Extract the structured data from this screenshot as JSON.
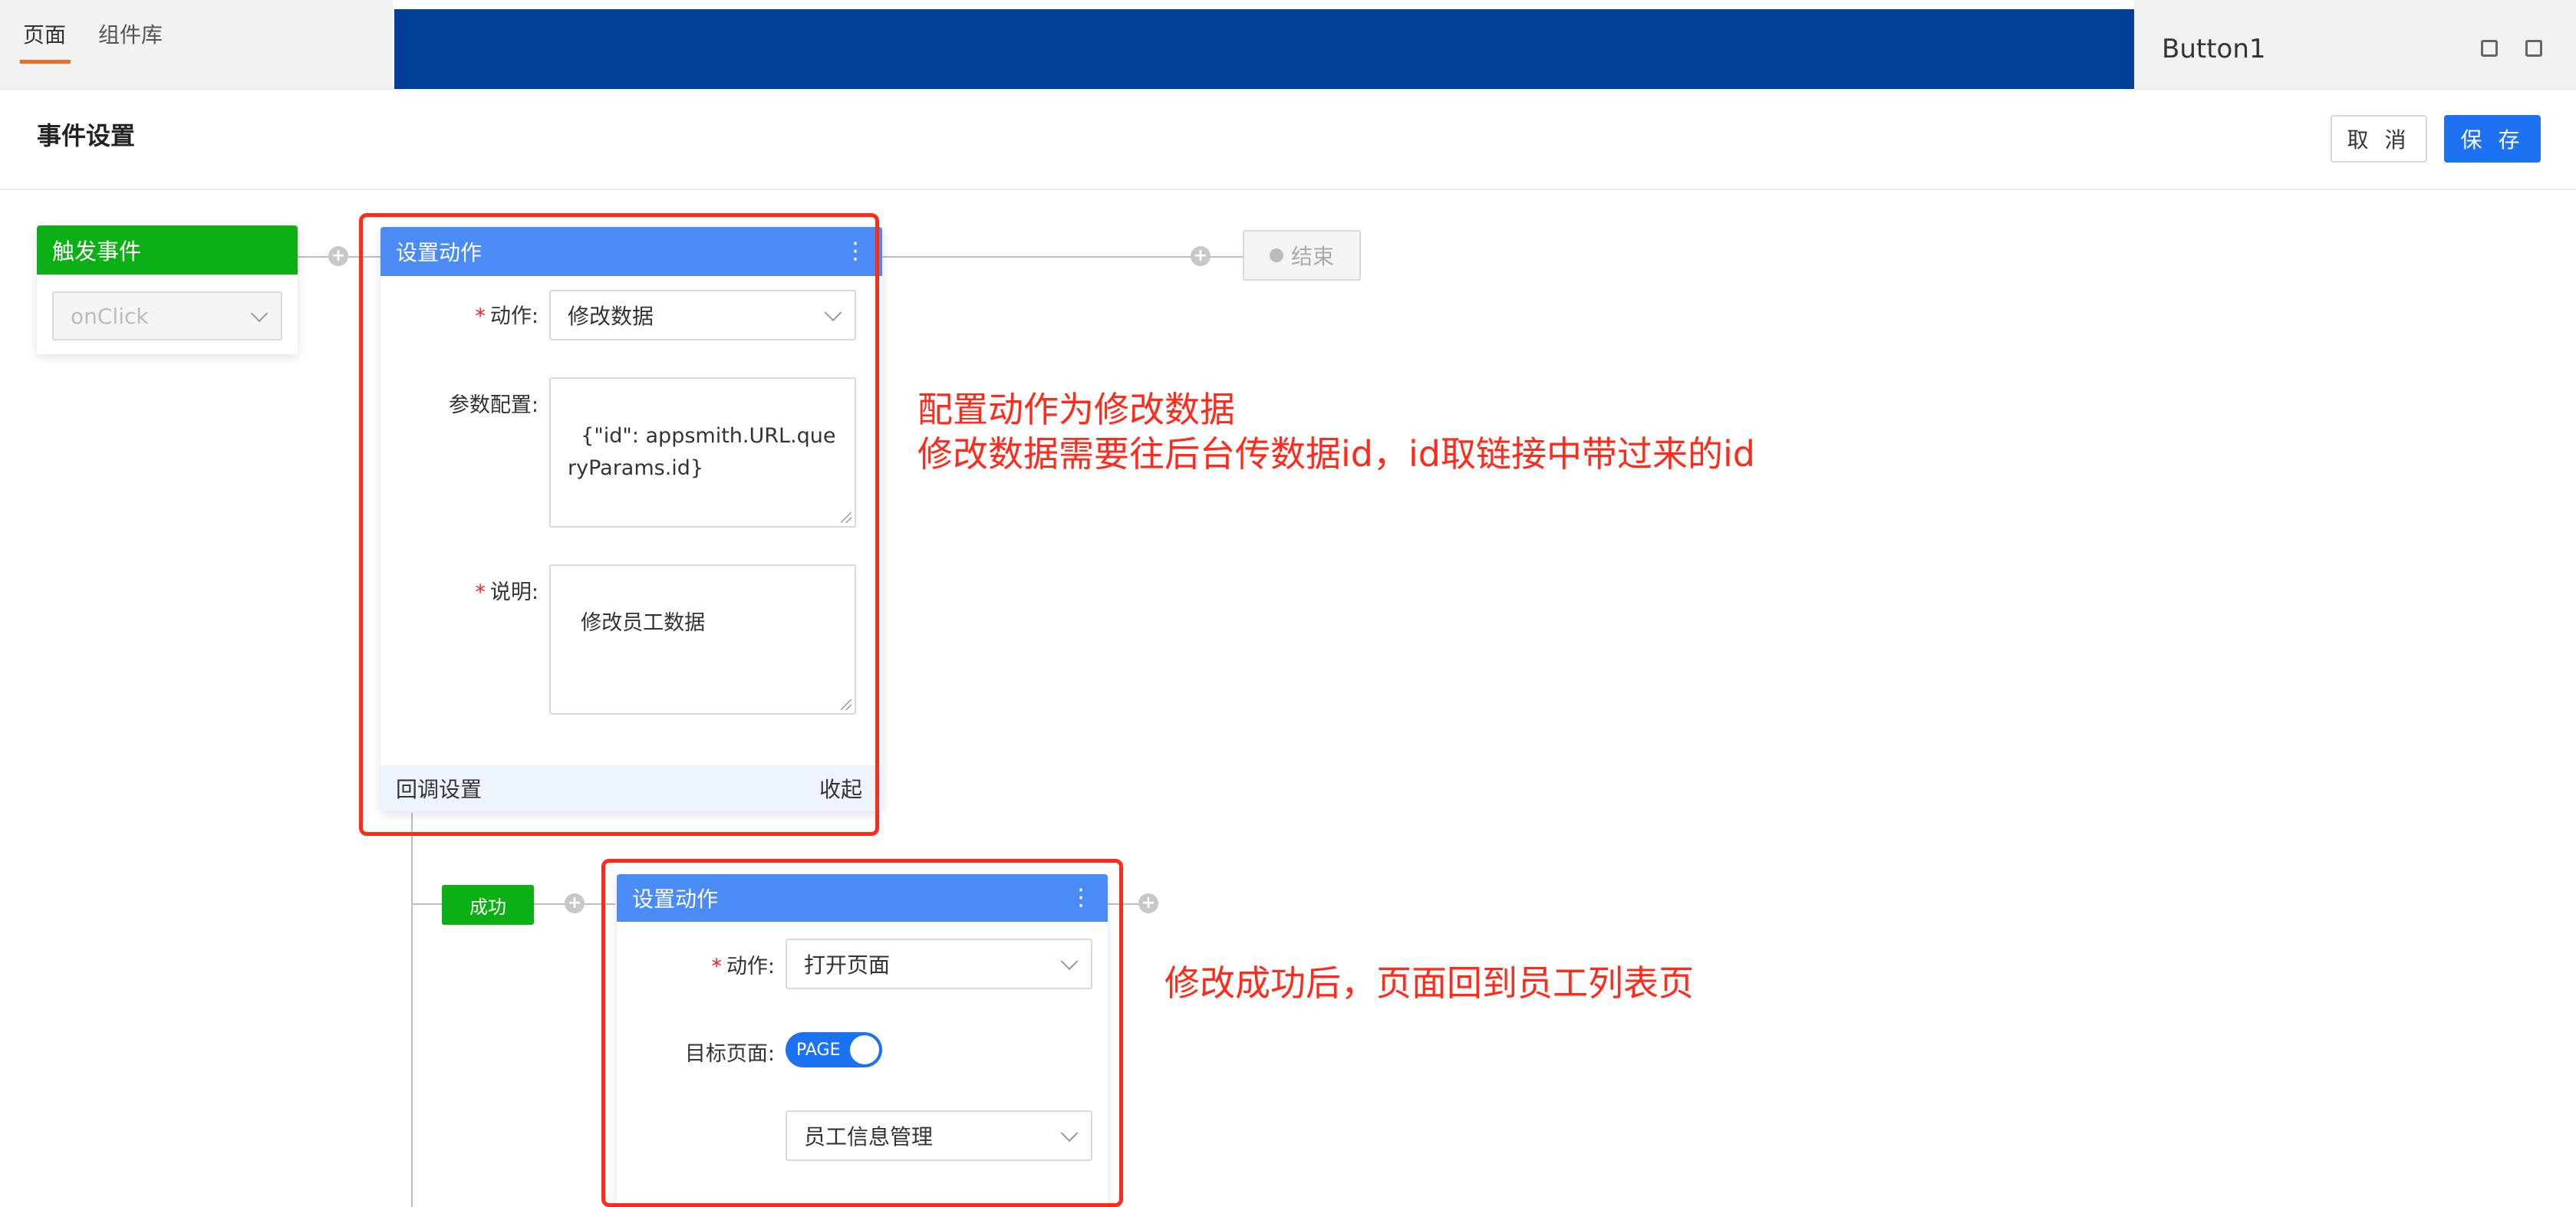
{
  "background": {
    "tabs": [
      {
        "label": "页面"
      },
      {
        "label": "组件库"
      }
    ],
    "widget_name": "Button1"
  },
  "modal": {
    "title": "事件设置",
    "cancel_label": "取 消",
    "save_label": "保 存"
  },
  "trigger": {
    "title": "触发事件",
    "event_value": "onClick"
  },
  "end_node": {
    "label": "结束"
  },
  "action1": {
    "title": "设置动作",
    "action_label": "动作:",
    "action_value": "修改数据",
    "params_label": "参数配置:",
    "params_value": "{\"id\": appsmith.URL.queryParams.id}",
    "desc_label": "说明:",
    "desc_value": "修改员工数据",
    "callback_label": "回调设置",
    "collapse_label": "收起"
  },
  "success_label": "成功",
  "action2": {
    "title": "设置动作",
    "action_label": "动作:",
    "action_value": "打开页面",
    "target_label": "目标页面:",
    "toggle_label": "PAGE",
    "page_value": "员工信息管理"
  },
  "annotations": {
    "note1_line1": "配置动作为修改数据",
    "note1_line2": "修改数据需要往后台传数据id，id取链接中带过来的id",
    "note2": "修改成功后，页面回到员工列表页"
  },
  "colors": {
    "primary": "#1d72f2",
    "action_header": "#4b8bf5",
    "trigger_header": "#0db014",
    "annotation": "#ff2a1a"
  }
}
